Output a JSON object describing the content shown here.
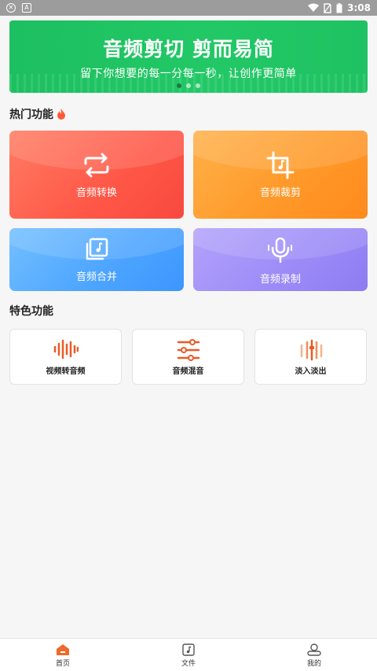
{
  "status_bar": {
    "time": "3:08"
  },
  "banner": {
    "title": "音频剪切 剪而易简",
    "subtitle": "留下你想要的每一分每一秒，让创作更简单"
  },
  "hot_section": {
    "title": "热门功能",
    "items": [
      {
        "label": "音频转换",
        "icon": "repeat-arrows-icon"
      },
      {
        "label": "音频裁剪",
        "icon": "crop-music-icon"
      },
      {
        "label": "音频合并",
        "icon": "merge-music-icon"
      },
      {
        "label": "音频录制",
        "icon": "microphone-icon"
      }
    ]
  },
  "special_section": {
    "title": "特色功能",
    "items": [
      {
        "label": "视频转音频",
        "icon": "waveform-icon"
      },
      {
        "label": "音频混音",
        "icon": "mixer-sliders-icon"
      },
      {
        "label": "淡入淡出",
        "icon": "fade-equalizer-icon"
      }
    ]
  },
  "bottom_nav": {
    "items": [
      {
        "label": "首页",
        "icon": "home-icon",
        "active": true
      },
      {
        "label": "文件",
        "icon": "music-file-icon",
        "active": false
      },
      {
        "label": "我的",
        "icon": "profile-icon",
        "active": false
      }
    ]
  },
  "colors": {
    "banner": "#1fc262",
    "convert_card": "#ff5b4c",
    "crop_card": "#ff9626",
    "merge_card": "#4aa4ff",
    "record_card": "#9d8cf7",
    "accent_orange": "#f06a2b"
  }
}
